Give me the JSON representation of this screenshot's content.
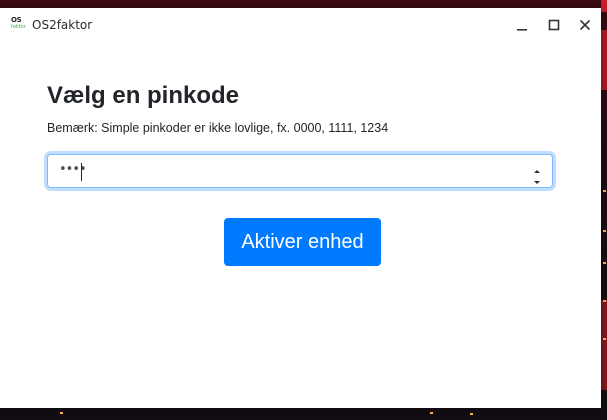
{
  "window": {
    "title": "OS2faktor",
    "logo_top": "OS",
    "logo_bottom": "faktor"
  },
  "icons": {
    "minimize": "minimize-icon",
    "maximize": "maximize-icon",
    "close": "close-icon",
    "spin_up": "chevron-up-icon",
    "spin_down": "chevron-down-icon"
  },
  "main": {
    "heading": "Vælg en pinkode",
    "note": "Bemærk: Simple pinkoder er ikke lovlige, fx. 0000, 1111, 1234",
    "pin_masked": "••••",
    "activate_label": "Aktiver enhed"
  },
  "colors": {
    "accent": "#007bff",
    "focus_border": "#80bdff",
    "text": "#212529"
  }
}
